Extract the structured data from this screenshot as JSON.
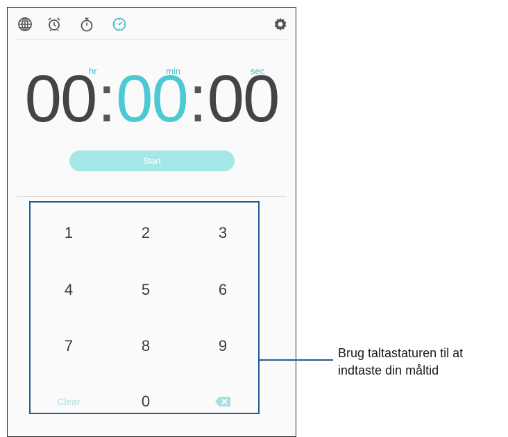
{
  "tabs": {
    "world_clock_icon": "globe-icon",
    "alarm_icon": "alarm-clock-icon",
    "stopwatch_icon": "stopwatch-icon",
    "timer_icon": "timer-icon",
    "settings_icon": "gear-icon"
  },
  "timer": {
    "unit_hr": "hr",
    "unit_min": "min",
    "unit_sec": "sec",
    "hours": "00",
    "minutes": "00",
    "seconds": "00",
    "separator": ":",
    "start_label": "Start"
  },
  "keypad": {
    "keys": [
      "1",
      "2",
      "3",
      "4",
      "5",
      "6",
      "7",
      "8",
      "9"
    ],
    "clear_label": "Clear",
    "zero_label": "0",
    "backspace_icon": "backspace-icon"
  },
  "callout": {
    "line1": "Brug taltastaturen til at",
    "line2": "indtaste din måltid"
  },
  "colors": {
    "accent": "#4cc9d3",
    "start_button": "#a5e6e6",
    "callout_border": "#1f5d94"
  }
}
